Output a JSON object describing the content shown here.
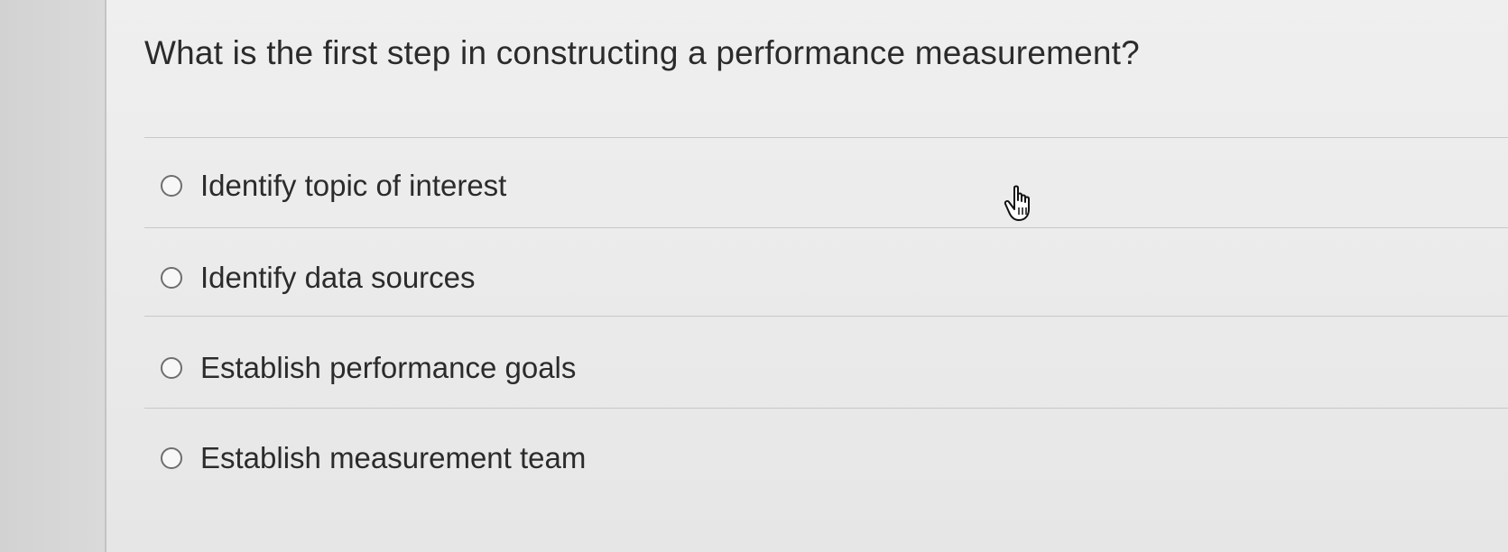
{
  "question": {
    "text": "What is the first step in constructing a performance measurement?"
  },
  "options": [
    {
      "label": "Identify topic of interest",
      "selected": false
    },
    {
      "label": "Identify data sources",
      "selected": false
    },
    {
      "label": "Establish performance goals",
      "selected": false
    },
    {
      "label": "Establish measurement team",
      "selected": false
    }
  ],
  "cursor": {
    "icon": "hand-pointer-icon"
  }
}
